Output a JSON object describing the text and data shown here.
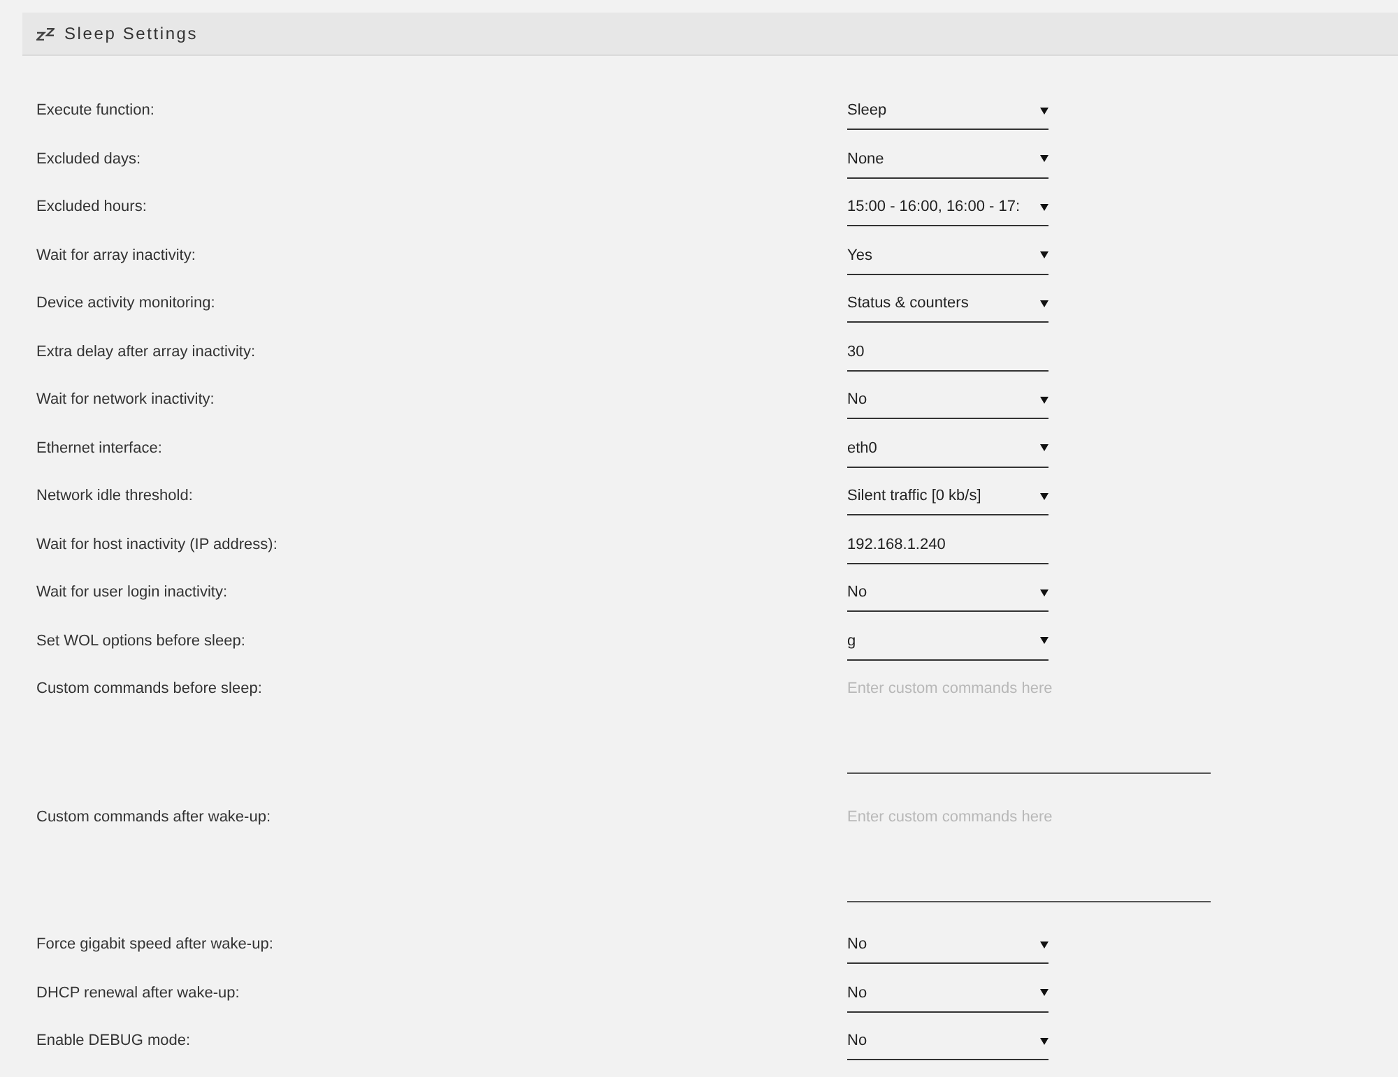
{
  "header": {
    "title": "Sleep Settings"
  },
  "settings": [
    {
      "label": "Execute function:",
      "kind": "select",
      "value": "Sleep"
    },
    {
      "label": "Excluded days:",
      "kind": "select",
      "value": "None"
    },
    {
      "label": "Excluded hours:",
      "kind": "select",
      "value": "15:00 - 16:00, 16:00 - 17:"
    },
    {
      "label": "Wait for array inactivity:",
      "kind": "select",
      "value": "Yes"
    },
    {
      "label": "Device activity monitoring:",
      "kind": "select",
      "value": "Status & counters"
    },
    {
      "label": "Extra delay after array inactivity:",
      "kind": "input",
      "value": "30"
    },
    {
      "label": "Wait for network inactivity:",
      "kind": "select",
      "value": "No"
    },
    {
      "label": "Ethernet interface:",
      "kind": "select",
      "value": "eth0"
    },
    {
      "label": "Network idle threshold:",
      "kind": "select",
      "value": "Silent traffic [0 kb/s]"
    },
    {
      "label": "Wait for host inactivity (IP address):",
      "kind": "input",
      "value": "192.168.1.240"
    },
    {
      "label": "Wait for user login inactivity:",
      "kind": "select",
      "value": "No"
    },
    {
      "label": "Set WOL options before sleep:",
      "kind": "select",
      "value": "g"
    },
    {
      "label": "Custom commands before sleep:",
      "kind": "textarea",
      "placeholder": "Enter custom commands here"
    },
    {
      "label": "Custom commands after wake-up:",
      "kind": "textarea",
      "placeholder": "Enter custom commands here"
    },
    {
      "label": "Force gigabit speed after wake-up:",
      "kind": "select",
      "value": "No"
    },
    {
      "label": "DHCP renewal after wake-up:",
      "kind": "select",
      "value": "No"
    },
    {
      "label": "Enable DEBUG mode:",
      "kind": "select",
      "value": "No"
    }
  ]
}
